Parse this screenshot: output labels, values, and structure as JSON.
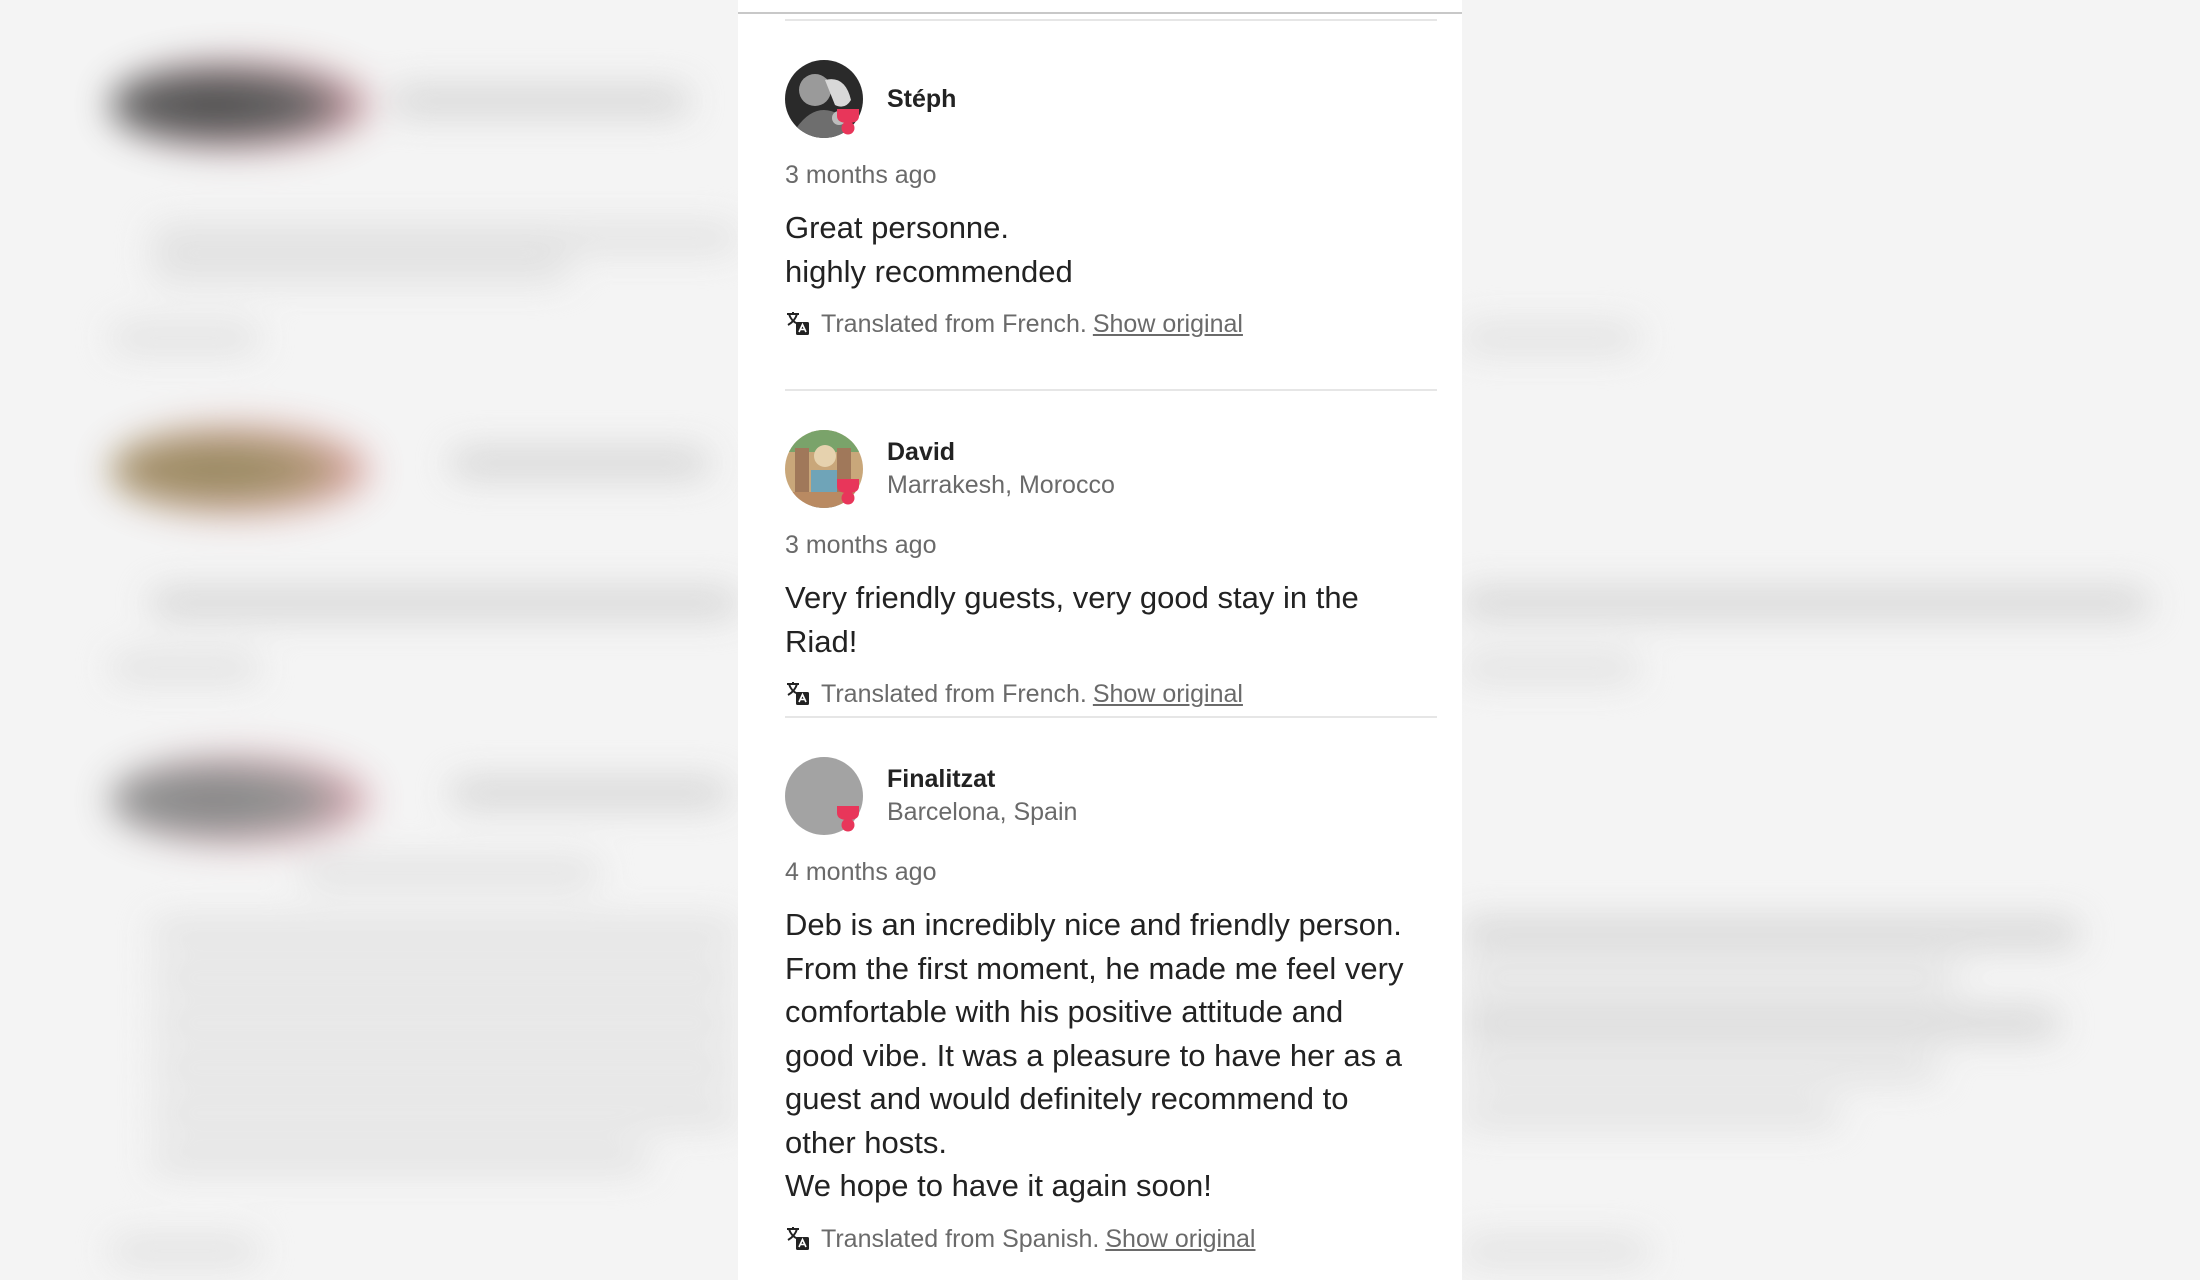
{
  "reviews": [
    {
      "name": "Stéph",
      "location": "",
      "date": "3 months ago",
      "text": "Great personne.\nhighly recommended",
      "translation_note": "Translated from French.",
      "show_original": "Show original"
    },
    {
      "name": "David",
      "location": "Marrakesh, Morocco",
      "date": "3 months ago",
      "text": "Very friendly guests, very good stay in the Riad!",
      "translation_note": "Translated from French.",
      "show_original": "Show original"
    },
    {
      "name": "Finalitzat",
      "location": "Barcelona, Spain",
      "date": "4 months ago",
      "text": "Deb is an incredibly nice and friendly person.\nFrom the first moment, he made me feel very\ncomfortable with his positive attitude and\ngood vibe. It was a pleasure to have her as a\nguest and would definitely recommend to\nother hosts.\nWe hope to have it again soon!",
      "translation_note": "Translated from Spanish.",
      "show_original": "Show original"
    }
  ],
  "colors": {
    "text": "#222222",
    "muted": "#6a6a6a",
    "badge": "#ff385c",
    "divider": "#e6e6e6"
  },
  "icons": {
    "translate": "translate-icon",
    "badge": "superhost-badge-icon"
  }
}
